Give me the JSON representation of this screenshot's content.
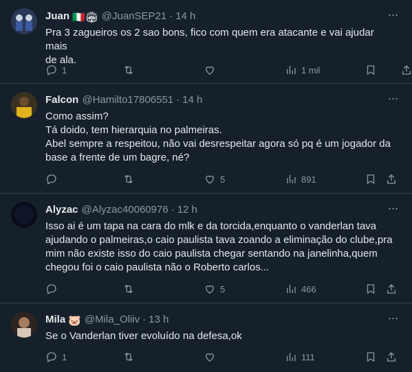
{
  "tweets": [
    {
      "name": "Juan",
      "flags": "🇮🇹🏟",
      "handle": "@JuanSEP21",
      "time": "14 h",
      "lines": [
        "Pra 3 zagueiros os 2 sao bons, fico com quem era atacante e vai ajudar mais",
        "de ala."
      ],
      "replies": "1",
      "retweets": "",
      "likes": "",
      "views": "1 mil",
      "avatar_color": "#3a4a6b"
    },
    {
      "name": "Falcon",
      "flags": "",
      "handle": "@Hamilto17806551",
      "time": "14 h",
      "lines": [
        "Como assim?",
        "Tá doido, tem hierarquia no palmeiras.",
        "Abel sempre a respeitou, não vai desrespeitar agora só pq é um jogador da",
        "base a frente de um bagre, né?"
      ],
      "replies": "",
      "retweets": "",
      "likes": "5",
      "views": "891",
      "avatar_color": "#c8a02a"
    },
    {
      "name": "Alyzac",
      "flags": "",
      "handle": "@Alyzac40060976",
      "time": "12 h",
      "lines": [
        "Isso ai é um tapa na cara do mlk e da torcida,enquanto o vanderlan tava",
        "ajudando o palmeiras,o caio paulista tava zoando a eliminação do clube,pra",
        "mim não existe isso do caio paulista chegar sentando na janelinha,quem",
        "chegou foi o caio paulista não o Roberto carlos..."
      ],
      "replies": "",
      "retweets": "",
      "likes": "5",
      "views": "466",
      "avatar_color": "#0a0c1a"
    },
    {
      "name": "Mila",
      "flags": "🐷",
      "handle": "@Mila_Oliiv",
      "time": "13 h",
      "lines": [
        "Se o Vanderlan tiver evoluído na defesa,ok"
      ],
      "replies": "1",
      "retweets": "",
      "likes": "",
      "views": "111",
      "avatar_color": "#6b4a36"
    }
  ],
  "more_icon": "more-horizontal-icon"
}
